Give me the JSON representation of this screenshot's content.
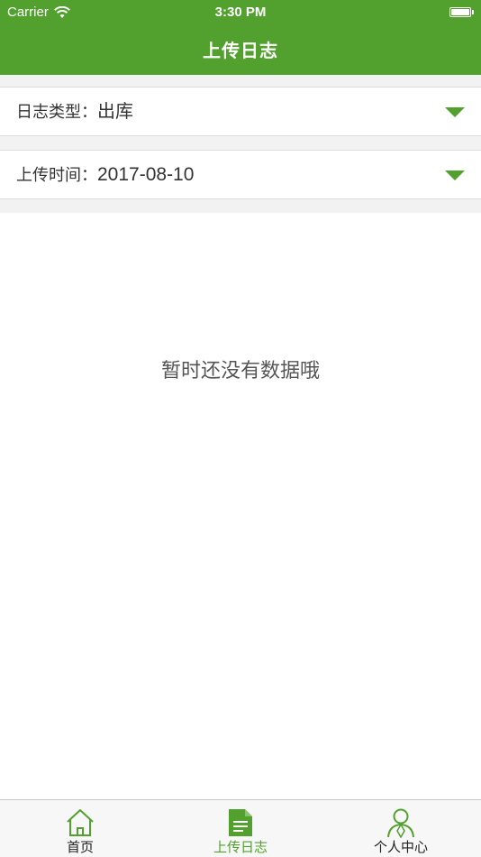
{
  "status_bar": {
    "carrier": "Carrier",
    "time": "3:30 PM",
    "wifi_icon": "wifi-icon",
    "battery_icon": "battery-icon"
  },
  "header": {
    "title": "上传日志"
  },
  "filters": {
    "log_type": {
      "label": "日志类型：",
      "value": "出库",
      "icon": "chevron-down-icon"
    },
    "upload_date": {
      "label": "上传时间：",
      "value": "2017-08-10",
      "icon": "chevron-down-icon"
    }
  },
  "content": {
    "empty_message": "暂时还没有数据哦"
  },
  "tab_bar": {
    "tabs": [
      {
        "label": "首页",
        "icon": "home-icon",
        "active": false
      },
      {
        "label": "上传日志",
        "icon": "document-icon",
        "active": true
      },
      {
        "label": "个人中心",
        "icon": "user-icon",
        "active": false
      }
    ]
  },
  "colors": {
    "brand": "#52a12e",
    "background": "#f2f2f2",
    "text": "#333333"
  }
}
